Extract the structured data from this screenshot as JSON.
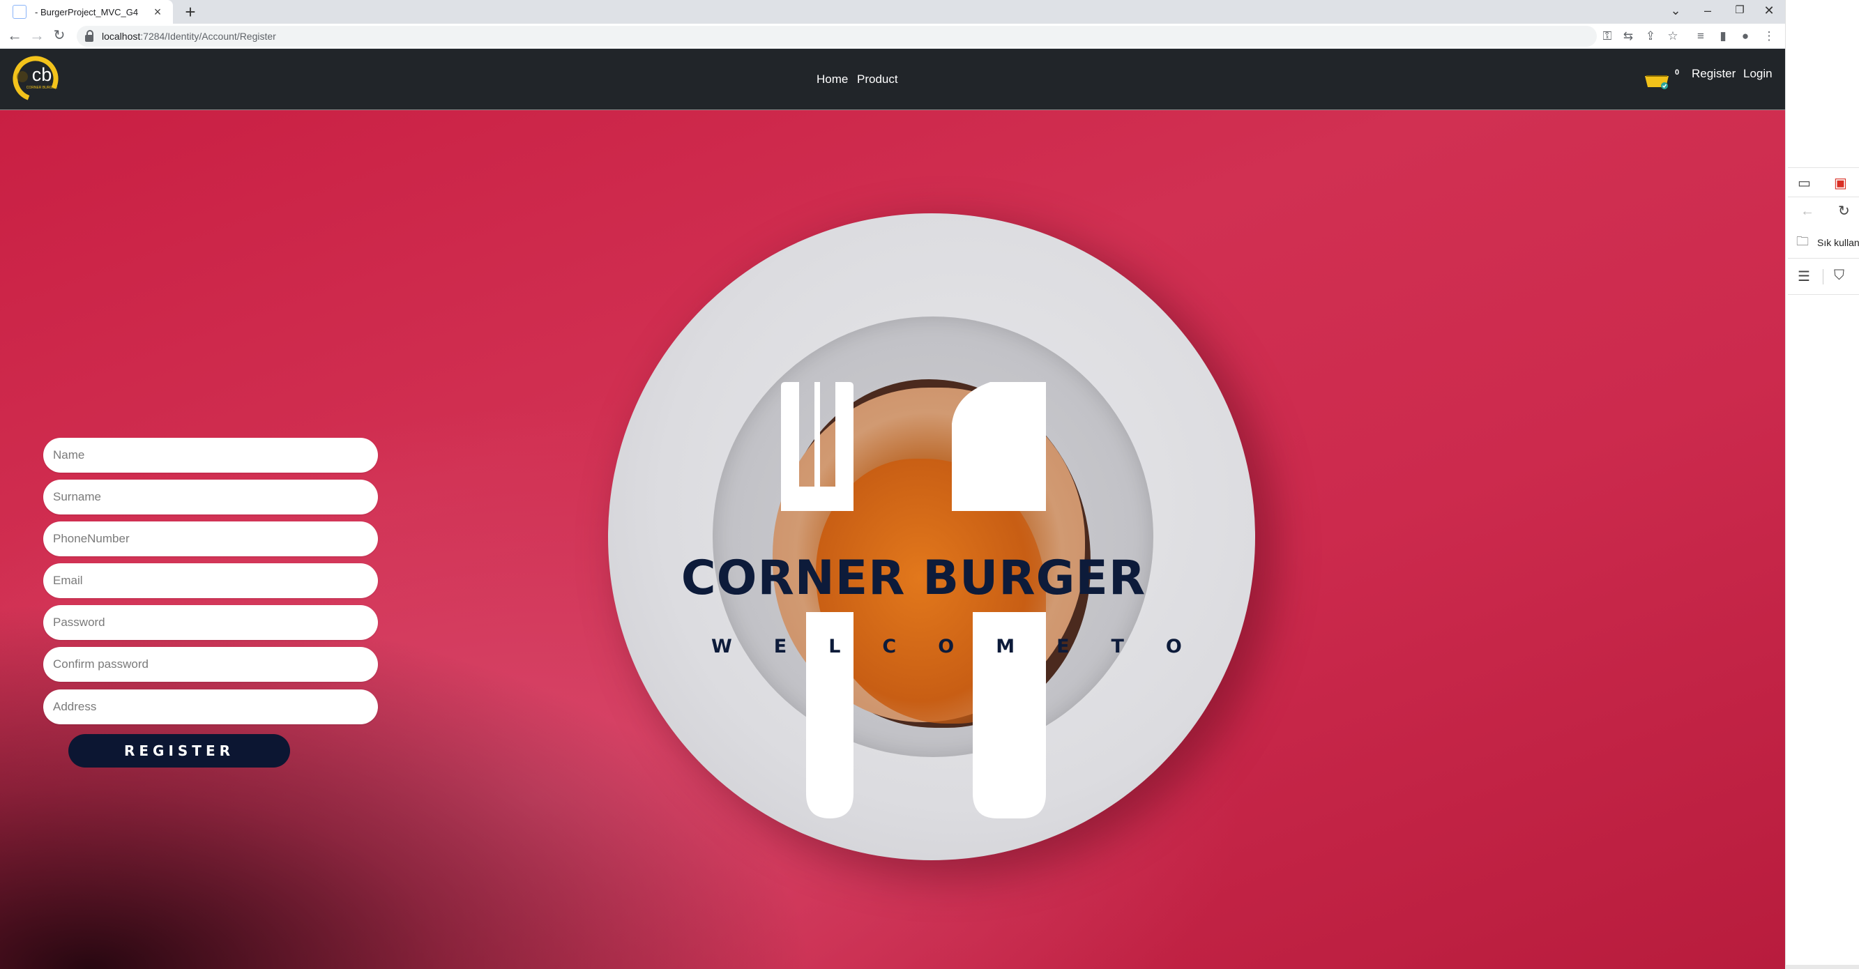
{
  "browser": {
    "tab_title": "- BurgerProject_MVC_G4",
    "new_tab": "+",
    "url_host": "localhost",
    "url_path": ":7284/Identity/Account/Register",
    "window_controls": [
      "⌄",
      "–",
      "❐",
      "✕"
    ]
  },
  "site": {
    "logo_text": "cb",
    "logo_subtext": "CORNER BURGER",
    "nav": {
      "home": "Home",
      "product": "Product"
    },
    "cart_count": "0",
    "register_link": "Register",
    "login_link": "Login"
  },
  "hero": {
    "title": "CORNER BURGER",
    "subtitle": "WELCOMETO"
  },
  "form": {
    "fields": [
      {
        "placeholder": "Name"
      },
      {
        "placeholder": "Surname"
      },
      {
        "placeholder": "PhoneNumber"
      },
      {
        "placeholder": "Email"
      },
      {
        "placeholder": "Password"
      },
      {
        "placeholder": "Confirm password"
      },
      {
        "placeholder": "Address"
      }
    ],
    "submit_label": "REGISTER"
  },
  "sidepanel": {
    "favorites_label": "Sık kullan"
  },
  "colors": {
    "navbar": "#212529",
    "hero_red": "#cc2a4d",
    "brand_navy": "#0d1b3a",
    "button": "#0c1632"
  }
}
